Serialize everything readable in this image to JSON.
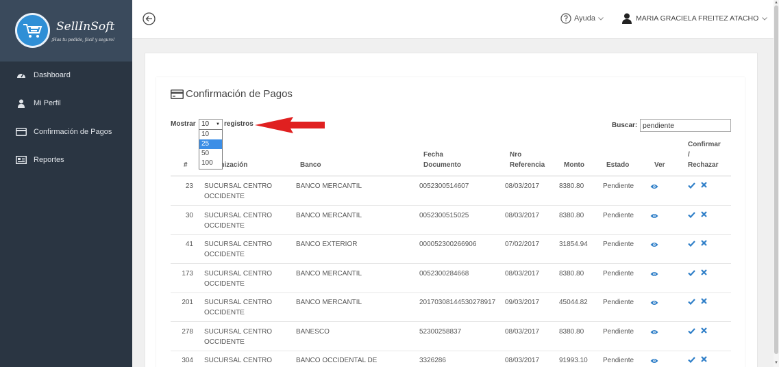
{
  "brand": {
    "name": "SellInSoft",
    "tagline": "¡Has tu pedido, fácil y seguro!"
  },
  "sidebar": {
    "items": [
      {
        "label": "Dashboard",
        "icon": "dashboard-icon"
      },
      {
        "label": "Mi Perfil",
        "icon": "user-icon"
      },
      {
        "label": "Confirmación de Pagos",
        "icon": "credit-card-icon"
      },
      {
        "label": "Reportes",
        "icon": "report-icon"
      }
    ]
  },
  "topbar": {
    "help_label": "Ayuda",
    "user_name": "MARIA GRACIELA FREITEZ ATACHO"
  },
  "page": {
    "title": "Confirmación de Pagos",
    "show_label": "Mostrar",
    "show_value": "10",
    "records_label": "registros",
    "page_size_options": [
      "10",
      "25",
      "50",
      "100"
    ],
    "highlighted_option": "25",
    "search_label": "Buscar:",
    "search_value": "pendiente"
  },
  "table": {
    "headers": {
      "num": "#",
      "org": "Organización",
      "bank": "Banco",
      "fecha_1": "Fecha",
      "fecha_2": "Documento",
      "nro_1": "Nro",
      "nro_2": "Referencia",
      "monto": "Monto",
      "estado": "Estado",
      "ver": "Ver",
      "conf_1": "Confirmar",
      "conf_2": "/",
      "conf_3": "Rechazar"
    },
    "rows": [
      {
        "id": "23",
        "org_1": "SUCURSAL CENTRO",
        "org_2": "OCCIDENTE",
        "bank": "BANCO MERCANTIL",
        "doc": "0052300514607",
        "ref": "08/03/2017",
        "monto": "8380.80",
        "estado": "Pendiente"
      },
      {
        "id": "30",
        "org_1": "SUCURSAL CENTRO",
        "org_2": "OCCIDENTE",
        "bank": "BANCO MERCANTIL",
        "doc": "0052300515025",
        "ref": "08/03/2017",
        "monto": "8380.80",
        "estado": "Pendiente"
      },
      {
        "id": "41",
        "org_1": "SUCURSAL CENTRO",
        "org_2": "OCCIDENTE",
        "bank": "BANCO EXTERIOR",
        "doc": "000052300266906",
        "ref": "07/02/2017",
        "monto": "31854.94",
        "estado": "Pendiente"
      },
      {
        "id": "173",
        "org_1": "SUCURSAL CENTRO",
        "org_2": "OCCIDENTE",
        "bank": "BANCO MERCANTIL",
        "doc": "0052300284668",
        "ref": "08/03/2017",
        "monto": "8380.80",
        "estado": "Pendiente"
      },
      {
        "id": "201",
        "org_1": "SUCURSAL CENTRO",
        "org_2": "OCCIDENTE",
        "bank": "BANCO MERCANTIL",
        "doc": "20170308144530278917",
        "ref": "09/03/2017",
        "monto": "45044.82",
        "estado": "Pendiente"
      },
      {
        "id": "278",
        "org_1": "SUCURSAL CENTRO",
        "org_2": "OCCIDENTE",
        "bank": "BANESCO",
        "doc": "52300258837",
        "ref": "08/03/2017",
        "monto": "8380.80",
        "estado": "Pendiente"
      },
      {
        "id": "304",
        "org_1": "SUCURSAL CENTRO",
        "org_2": "",
        "bank": "BANCO OCCIDENTAL DE",
        "doc": "3326286",
        "ref": "08/03/2017",
        "monto": "91993.10",
        "estado": "Pendiente"
      }
    ]
  },
  "colors": {
    "sidebar_bg": "#2a3542",
    "brand_bg": "#3a4a5c",
    "action_blue": "#2f7fc8",
    "dropdown_highlight": "#3c8ee6",
    "annotation_arrow": "#e02020"
  }
}
